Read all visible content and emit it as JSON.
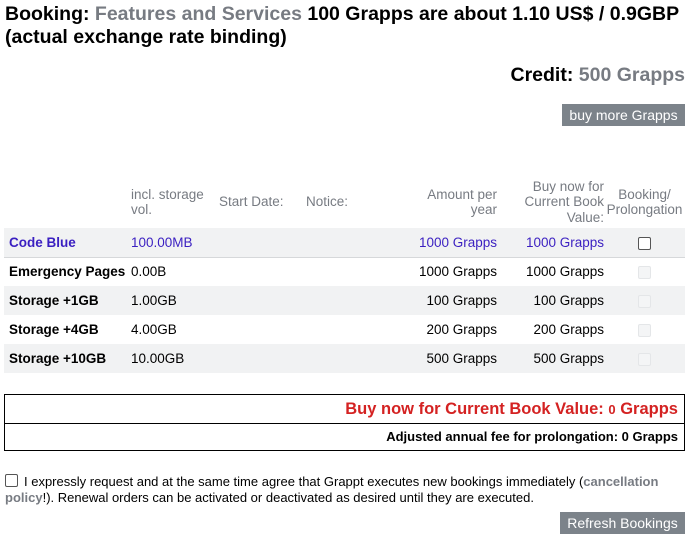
{
  "header": {
    "label": "Booking:",
    "section": "Features and Services",
    "rate": "100 Grapps are about 1.10 US$ / 0.9GBP (actual exchange rate binding)"
  },
  "credit": {
    "label": "Credit:",
    "value": "500 Grapps"
  },
  "buttons": {
    "buy_more": "buy more Grapps",
    "refresh": "Refresh Bookings"
  },
  "table": {
    "columns": {
      "storage": "incl. storage vol.",
      "start_date": "Start Date:",
      "notice": "Notice:",
      "amount": "Amount per year",
      "buy_now": "Buy now for Current Book Value:",
      "booking": "Booking/ Prolongation"
    },
    "rows": [
      {
        "name": "Code Blue",
        "storage": "100.00MB",
        "amount": "1000 Grapps",
        "buy": "1000 Grapps",
        "checked": false,
        "enabled": true,
        "highlight": true
      },
      {
        "name": "Emergency Pages",
        "storage": "0.00B",
        "amount": "1000 Grapps",
        "buy": "1000 Grapps",
        "checked": false,
        "enabled": false,
        "highlight": false
      },
      {
        "name": "Storage +1GB",
        "storage": "1.00GB",
        "amount": "100 Grapps",
        "buy": "100 Grapps",
        "checked": false,
        "enabled": false,
        "highlight": false
      },
      {
        "name": "Storage +4GB",
        "storage": "4.00GB",
        "amount": "200 Grapps",
        "buy": "200 Grapps",
        "checked": false,
        "enabled": false,
        "highlight": false
      },
      {
        "name": "Storage +10GB",
        "storage": "10.00GB",
        "amount": "500 Grapps",
        "buy": "500 Grapps",
        "checked": false,
        "enabled": false,
        "highlight": false
      }
    ]
  },
  "summary": {
    "buy_now_label": "Buy now for Current Book Value:",
    "buy_now_value": "0",
    "buy_now_unit": "Grapps",
    "prolongation": "Adjusted annual fee for prolongation: 0 Grapps"
  },
  "agreement": {
    "text_before": "I expressly request and at the same time agree that Grappt executes new bookings immediately (",
    "link": "cancellation policy",
    "text_after": "!). Renewal orders can be activated or deactivated as desired until they are executed."
  },
  "colors": {
    "muted": "#777b82",
    "highlight": "#3a1fc1",
    "alert": "#d42222",
    "button_bg": "#7c838a"
  }
}
